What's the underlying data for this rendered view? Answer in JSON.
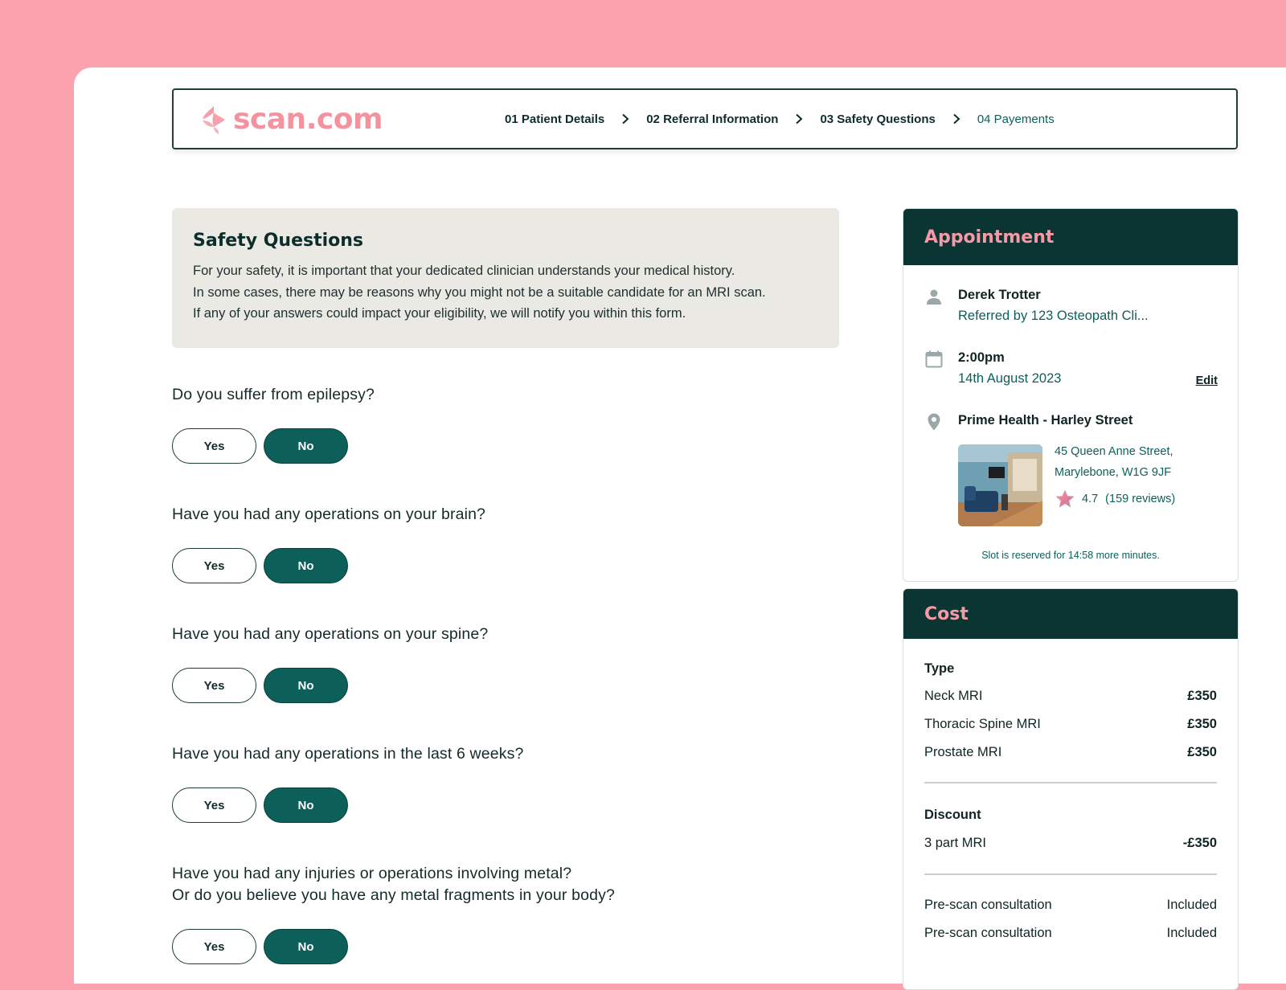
{
  "brand": {
    "name": "scan.com",
    "color": "#f4929f"
  },
  "steps": [
    {
      "label": "01 Patient Details",
      "state": "done"
    },
    {
      "label": "02 Referral Information",
      "state": "done"
    },
    {
      "label": "03 Safety Questions",
      "state": "current"
    },
    {
      "label": "04 Payements",
      "state": "future"
    }
  ],
  "intro": {
    "title": "Safety Questions",
    "lines": [
      "For your safety, it is important that your dedicated clinician understands your medical history.",
      "In some cases, there may be reasons why you might not be a suitable candidate for an MRI scan.",
      "If any of your answers could impact your eligibility, we will notify you within this form."
    ]
  },
  "questions": [
    {
      "lines": [
        "Do you suffer from epilepsy?"
      ],
      "yes": "Yes",
      "no": "No",
      "selected": "No"
    },
    {
      "lines": [
        "Have you had any operations on your brain?"
      ],
      "yes": "Yes",
      "no": "No",
      "selected": "No"
    },
    {
      "lines": [
        "Have you had any operations on your spine?"
      ],
      "yes": "Yes",
      "no": "No",
      "selected": "No"
    },
    {
      "lines": [
        "Have you had any operations in the last 6 weeks?"
      ],
      "yes": "Yes",
      "no": "No",
      "selected": "No"
    },
    {
      "lines": [
        "Have you had any injuries or operations involving metal?",
        "Or do you believe you have any metal fragments in your body?"
      ],
      "yes": "Yes",
      "no": "No",
      "selected": "No"
    }
  ],
  "appointment": {
    "title": "Appointment",
    "patient": {
      "name": "Derek Trotter",
      "referral": "Referred by 123 Osteopath Cli..."
    },
    "time": {
      "time": "2:00pm",
      "date": "14th August 2023",
      "edit_label": "Edit"
    },
    "clinic": {
      "name": "Prime Health - Harley Street",
      "address_line1": "45 Queen Anne Street,",
      "address_line2": "Marylebone, W1G 9JF",
      "rating": "4.7",
      "reviews": "(159 reviews)"
    },
    "reserved_note": "Slot is reserved for 14:58 more minutes."
  },
  "cost": {
    "title": "Cost",
    "type_label": "Type",
    "items": [
      {
        "name": "Neck MRI",
        "amount": "£350"
      },
      {
        "name": "Thoracic Spine MRI",
        "amount": "£350"
      },
      {
        "name": "Prostate MRI",
        "amount": "£350"
      }
    ],
    "discount_label": "Discount",
    "discount": {
      "name": "3 part MRI",
      "amount": "-£350"
    },
    "extras": [
      {
        "name": "Pre-scan consultation",
        "amount": "Included"
      },
      {
        "name": "Pre-scan consultation",
        "amount": "Included"
      }
    ]
  },
  "colors": {
    "background": "#fba2ae",
    "primary": "#0d5f5a",
    "dark": "#0b3533",
    "accent": "#f79aa6"
  }
}
